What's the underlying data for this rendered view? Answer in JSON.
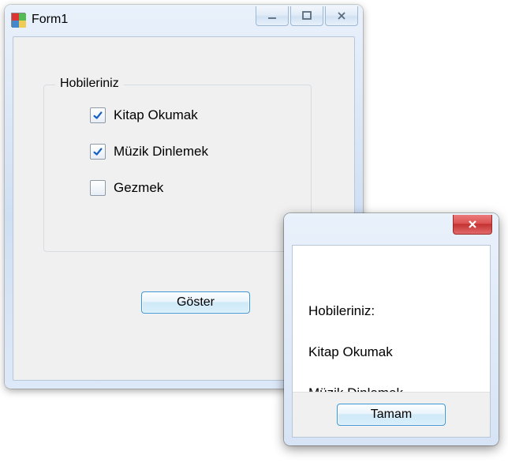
{
  "mainWindow": {
    "title": "Form1",
    "groupbox": {
      "legend": "Hobileriniz",
      "options": [
        {
          "label": "Kitap Okumak",
          "checked": true
        },
        {
          "label": "Müzik Dinlemek",
          "checked": true
        },
        {
          "label": "Gezmek",
          "checked": false
        }
      ]
    },
    "showButton": "Göster"
  },
  "messageBox": {
    "lines": [
      "Hobileriniz:",
      "Kitap Okumak",
      "Müzik Dinlemek"
    ],
    "okButton": "Tamam"
  }
}
